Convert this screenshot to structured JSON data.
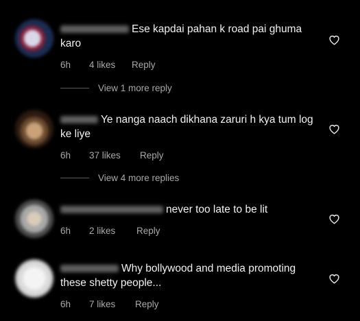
{
  "comments": [
    {
      "username": "avinash_2995",
      "text": "Ese kapdai pahan k road pai ghuma karo",
      "time": "6h",
      "likes": "4 likes",
      "reply_label": "Reply",
      "view_replies": "View 1 more reply",
      "avatar_colors": [
        "#1b2c52",
        "#8a1f3a",
        "#d9d9e8"
      ]
    },
    {
      "username": "me__dv",
      "text": "Ye nanga naach dikhana zaruri h kya tum log ke liye",
      "time": "6h",
      "likes": "37 likes",
      "reply_label": "Reply",
      "view_replies": "View 4 more replies",
      "avatar_colors": [
        "#c9a27a",
        "#6b4a2f",
        "#2a1a10"
      ]
    },
    {
      "username": "_kamu.shukla_",
      "text": "never too late to be lit",
      "time": "6h",
      "likes": "2 likes",
      "reply_label": "Reply",
      "avatar_colors": [
        "#a8a8a8",
        "#d9cdb8",
        "#4a4a4a"
      ]
    },
    {
      "username": "kaenae2020",
      "text": "Why bollywood and media promoting these shetty people...",
      "time": "6h",
      "likes": "7 likes",
      "reply_label": "Reply",
      "avatar_colors": [
        "#f4f4f4",
        "#dcdcdc",
        "#bfbfbf"
      ]
    }
  ],
  "icons": {
    "like": "heart-outline-icon"
  },
  "colors": {
    "background": "#000000",
    "text": "#f2f2f2",
    "meta": "#a8a8a8"
  }
}
